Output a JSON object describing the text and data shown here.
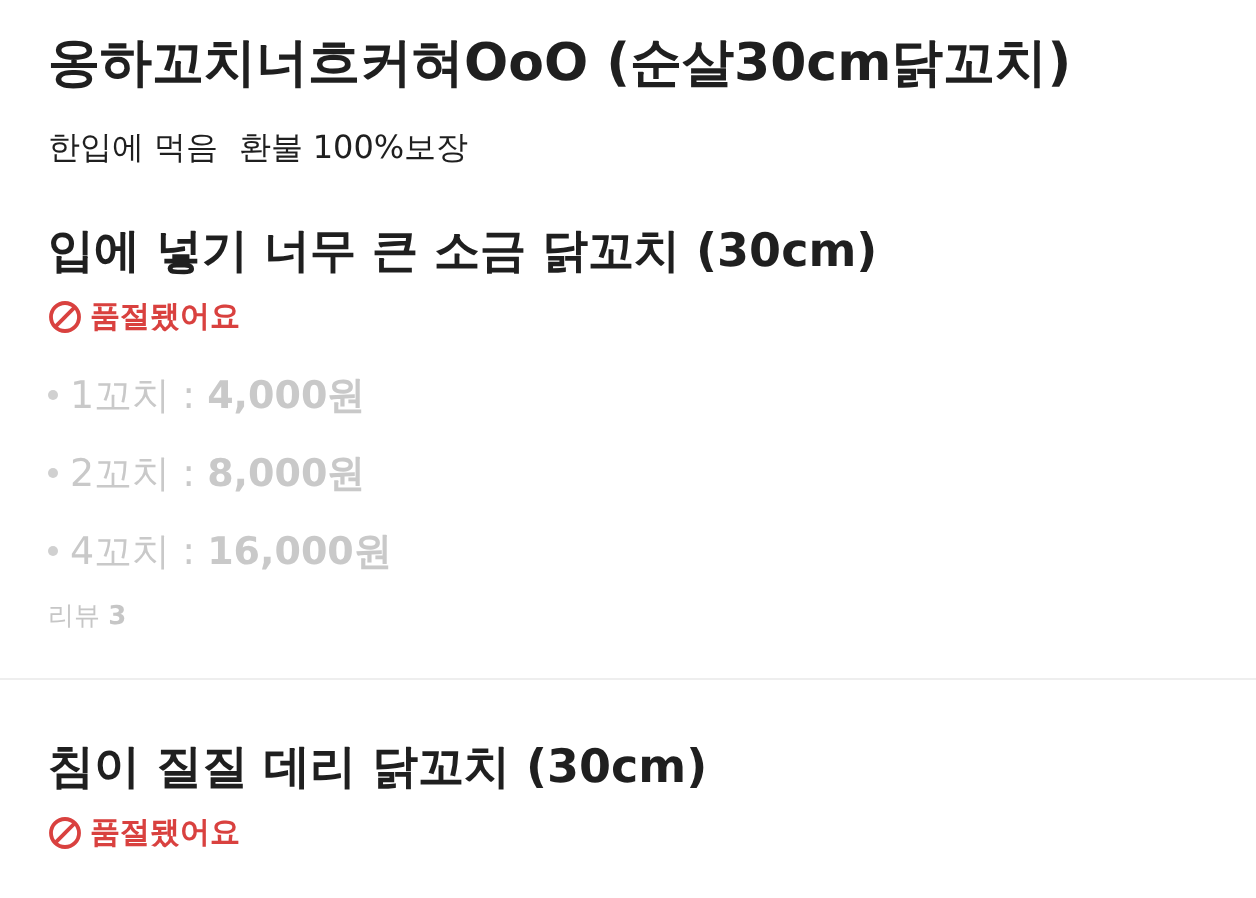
{
  "store": {
    "name": "옹하꼬치너흐커혀OoO (순살30cm닭꼬치)",
    "description": "한입에 먹음  환불 100%보장"
  },
  "menu_items": [
    {
      "name": "입에 넣기 너무 큰 소금 닭꼬치 (30cm)",
      "sold_out": true,
      "status": "품절됐어요",
      "options": [
        "1꼬치 : **4,000원**",
        "2꼬치 : **8,000원**",
        "4꼬치 : **16,000원**"
      ],
      "review": "리뷰 **3**"
    },
    {
      "name": "침이 질질 데리 닭꼬치 (30cm)",
      "sold_out": true,
      "status": "품절됐어요"
    }
  ]
}
